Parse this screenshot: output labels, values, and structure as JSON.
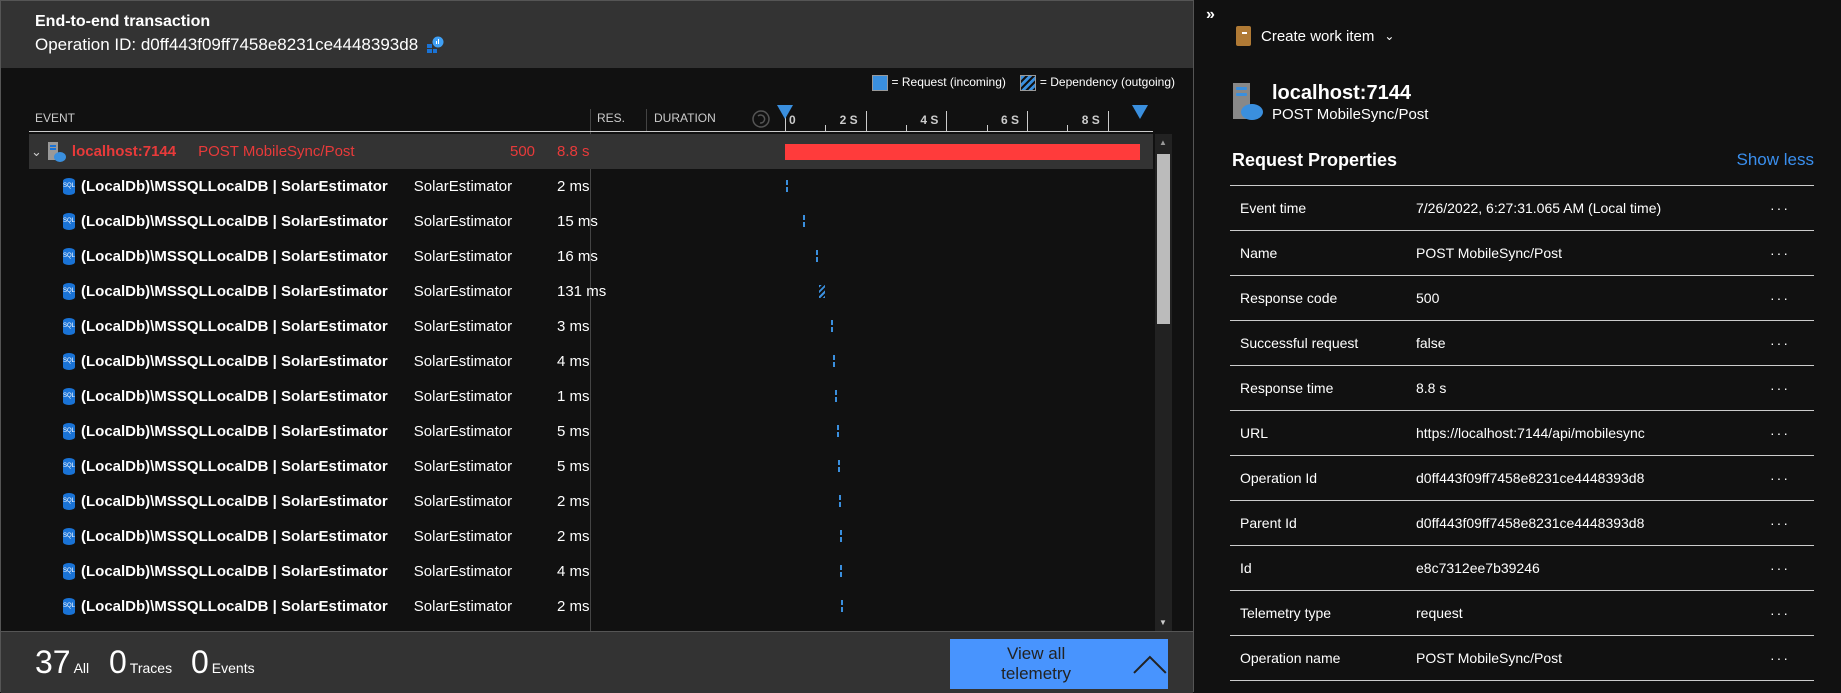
{
  "header": {
    "title": "End-to-end transaction",
    "operation_id": "Operation ID: d0ff443f09ff7458e8231ce4448393d8"
  },
  "legend": {
    "request": "= Request (incoming)",
    "dependency": "= Dependency (outgoing)"
  },
  "columns": {
    "event": "EVENT",
    "res": "RES.",
    "duration": "DURATION"
  },
  "timeline": {
    "ticks": [
      "0",
      "2 S",
      "4 S",
      "6 S",
      "8 S"
    ],
    "max_seconds": 8.8,
    "colors": {
      "request_failed": "#ff3b3b",
      "dependency": "#3a8fde"
    }
  },
  "root": {
    "name": "localhost:7144",
    "op": "POST MobileSync/Post",
    "res": "500",
    "duration": "8.8 s",
    "start": 0,
    "length": 8.8
  },
  "dependencies": [
    {
      "name": "(LocalDb)\\MSSQLLocalDB | SolarEstimator",
      "target": "SolarEstimator",
      "duration": "2 ms",
      "start": 0.03,
      "length": 0.002
    },
    {
      "name": "(LocalDb)\\MSSQLLocalDB | SolarEstimator",
      "target": "SolarEstimator",
      "duration": "15 ms",
      "start": 0.44,
      "length": 0.015
    },
    {
      "name": "(LocalDb)\\MSSQLLocalDB | SolarEstimator",
      "target": "SolarEstimator",
      "duration": "16 ms",
      "start": 0.76,
      "length": 0.016
    },
    {
      "name": "(LocalDb)\\MSSQLLocalDB | SolarEstimator",
      "target": "SolarEstimator",
      "duration": "131 ms",
      "start": 0.85,
      "length": 0.131
    },
    {
      "name": "(LocalDb)\\MSSQLLocalDB | SolarEstimator",
      "target": "SolarEstimator",
      "duration": "3 ms",
      "start": 1.14,
      "length": 0.003
    },
    {
      "name": "(LocalDb)\\MSSQLLocalDB | SolarEstimator",
      "target": "SolarEstimator",
      "duration": "4 ms",
      "start": 1.2,
      "length": 0.004
    },
    {
      "name": "(LocalDb)\\MSSQLLocalDB | SolarEstimator",
      "target": "SolarEstimator",
      "duration": "1 ms",
      "start": 1.25,
      "length": 0.001
    },
    {
      "name": "(LocalDb)\\MSSQLLocalDB | SolarEstimator",
      "target": "SolarEstimator",
      "duration": "5 ms",
      "start": 1.28,
      "length": 0.005
    },
    {
      "name": "(LocalDb)\\MSSQLLocalDB | SolarEstimator",
      "target": "SolarEstimator",
      "duration": "5 ms",
      "start": 1.31,
      "length": 0.005
    },
    {
      "name": "(LocalDb)\\MSSQLLocalDB | SolarEstimator",
      "target": "SolarEstimator",
      "duration": "2 ms",
      "start": 1.34,
      "length": 0.002
    },
    {
      "name": "(LocalDb)\\MSSQLLocalDB | SolarEstimator",
      "target": "SolarEstimator",
      "duration": "2 ms",
      "start": 1.36,
      "length": 0.002
    },
    {
      "name": "(LocalDb)\\MSSQLLocalDB | SolarEstimator",
      "target": "SolarEstimator",
      "duration": "4 ms",
      "start": 1.37,
      "length": 0.004
    },
    {
      "name": "(LocalDb)\\MSSQLLocalDB | SolarEstimator",
      "target": "SolarEstimator",
      "duration": "2 ms",
      "start": 1.4,
      "length": 0.002
    }
  ],
  "footer": {
    "all_count": "37",
    "all_label": "All",
    "traces_count": "0",
    "traces_label": "Traces",
    "events_count": "0",
    "events_label": "Events",
    "view_all": "View all telemetry"
  },
  "side": {
    "collapse": "»",
    "create_work_item": "Create work item",
    "title": "localhost:7144",
    "subtitle": "POST MobileSync/Post",
    "section": "Request Properties",
    "show_less": "Show less",
    "more": "···",
    "properties": [
      {
        "k": "Event time",
        "v": "7/26/2022, 6:27:31.065 AM (Local time)"
      },
      {
        "k": "Name",
        "v": "POST MobileSync/Post"
      },
      {
        "k": "Response code",
        "v": "500"
      },
      {
        "k": "Successful request",
        "v": "false"
      },
      {
        "k": "Response time",
        "v": "8.8 s"
      },
      {
        "k": "URL",
        "v": "https://localhost:7144/api/mobilesync"
      },
      {
        "k": "Operation Id",
        "v": "d0ff443f09ff7458e8231ce4448393d8"
      },
      {
        "k": "Parent Id",
        "v": "d0ff443f09ff7458e8231ce4448393d8"
      },
      {
        "k": "Id",
        "v": "e8c7312ee7b39246"
      },
      {
        "k": "Telemetry type",
        "v": "request"
      },
      {
        "k": "Operation name",
        "v": "POST MobileSync/Post"
      }
    ]
  }
}
